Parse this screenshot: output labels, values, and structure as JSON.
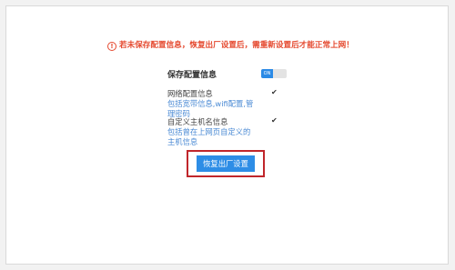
{
  "warning": {
    "icon": "info-circle-icon",
    "text": "若未保存配置信息，恢复出厂设置后，需重新设置后才能正常上网！"
  },
  "save_config": {
    "label": "保存配置信息",
    "toggle_text": "ON",
    "toggle_on": true
  },
  "options": [
    {
      "label": "网络配置信息",
      "desc_line1": "包括宽带信息,wifi配置,管",
      "desc_line2": "理密码",
      "checked": true
    },
    {
      "label": "自定义主机名信息",
      "desc_line1": "包括曾在上网页自定义的",
      "desc_line2": "主机信息",
      "checked": true
    }
  ],
  "restore_button": {
    "label": "恢复出厂设置"
  },
  "colors": {
    "accent": "#2d8de6",
    "warning": "#e5492f",
    "highlight": "#c0262b"
  }
}
